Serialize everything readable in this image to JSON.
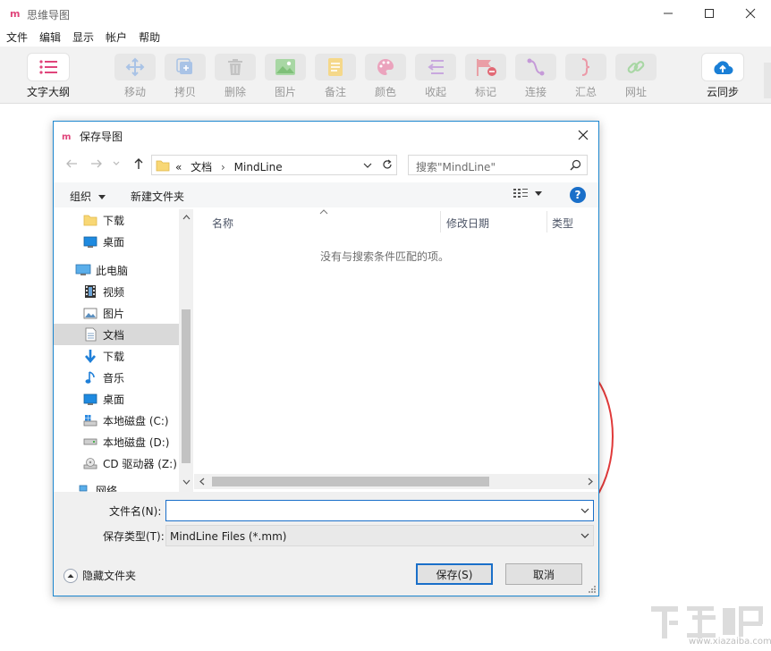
{
  "app": {
    "title": "思维导图",
    "menu": [
      "文件",
      "编辑",
      "显示",
      "帐户",
      "帮助"
    ],
    "toolbar": [
      {
        "label": "文字大纲",
        "icon": "outline-list-icon",
        "enabled": true
      },
      {
        "label": "移动",
        "icon": "move-icon",
        "enabled": false
      },
      {
        "label": "拷贝",
        "icon": "copy-icon",
        "enabled": false
      },
      {
        "label": "删除",
        "icon": "trash-icon",
        "enabled": false
      },
      {
        "label": "图片",
        "icon": "image-icon",
        "enabled": false
      },
      {
        "label": "备注",
        "icon": "note-icon",
        "enabled": false
      },
      {
        "label": "颜色",
        "icon": "palette-icon",
        "enabled": false
      },
      {
        "label": "收起",
        "icon": "collapse-icon",
        "enabled": false
      },
      {
        "label": "标记",
        "icon": "flag-icon",
        "enabled": false
      },
      {
        "label": "连接",
        "icon": "connect-icon",
        "enabled": false
      },
      {
        "label": "汇总",
        "icon": "brace-icon",
        "enabled": false
      },
      {
        "label": "网址",
        "icon": "link-icon",
        "enabled": false
      },
      {
        "label": "云同步",
        "icon": "cloud-upload-icon",
        "enabled": true
      }
    ]
  },
  "dialog": {
    "title": "保存导图",
    "address": {
      "prefix": "«",
      "crumbs": [
        "文档",
        "MindLine"
      ]
    },
    "search_placeholder": "搜索\"MindLine\"",
    "organize_label": "组织",
    "new_folder_label": "新建文件夹",
    "nav_items": [
      {
        "label": "下载",
        "icon": "folder-icon",
        "level": 2,
        "selected": false
      },
      {
        "label": "桌面",
        "icon": "desktop-icon",
        "level": 2,
        "selected": false
      },
      {
        "label": "此电脑",
        "icon": "computer-icon",
        "level": 1,
        "selected": false
      },
      {
        "label": "视频",
        "icon": "video-icon",
        "level": 2,
        "selected": false
      },
      {
        "label": "图片",
        "icon": "pictures-icon",
        "level": 2,
        "selected": false
      },
      {
        "label": "文档",
        "icon": "documents-icon",
        "level": 2,
        "selected": true
      },
      {
        "label": "下载",
        "icon": "download-icon",
        "level": 2,
        "selected": false
      },
      {
        "label": "音乐",
        "icon": "music-icon",
        "level": 2,
        "selected": false
      },
      {
        "label": "桌面",
        "icon": "desktop-icon",
        "level": 2,
        "selected": false
      },
      {
        "label": "本地磁盘 (C:)",
        "icon": "drive-c-icon",
        "level": 2,
        "selected": false
      },
      {
        "label": "本地磁盘 (D:)",
        "icon": "drive-icon",
        "level": 2,
        "selected": false
      },
      {
        "label": "CD 驱动器 (Z:)",
        "icon": "cd-drive-icon",
        "level": 2,
        "selected": false
      },
      {
        "label": "网络",
        "icon": "network-icon",
        "level": 1,
        "selected": false
      }
    ],
    "columns": {
      "name": "名称",
      "modified": "修改日期",
      "type": "类型"
    },
    "empty_message": "没有与搜索条件匹配的项。",
    "filename_label": "文件名(N):",
    "filename_value": "",
    "filetype_label": "保存类型(T):",
    "filetype_value": "MindLine Files (*.mm)",
    "hide_folders_label": "隐藏文件夹",
    "save_label": "保存(S)",
    "cancel_label": "取消"
  },
  "watermark": {
    "text": "www.xiazaiba.com"
  }
}
